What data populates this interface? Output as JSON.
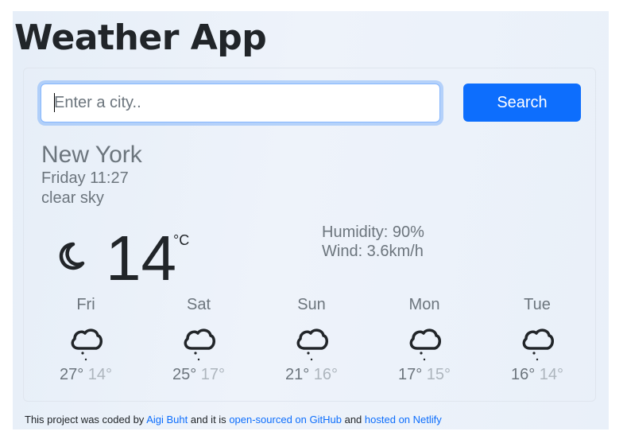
{
  "app": {
    "title": "Weather App"
  },
  "search": {
    "placeholder": "Enter a city..",
    "button_label": "Search"
  },
  "current": {
    "city": "New York",
    "datetime": "Friday 11:27",
    "description": "clear sky",
    "icon": "moon-icon",
    "temperature": "14",
    "unit": "°C",
    "humidity": "Humidity: 90%",
    "wind": "Wind: 3.6km/h"
  },
  "forecast": [
    {
      "day": "Fri",
      "max": "27°",
      "min": "14°",
      "icon": "cloud-drizzle-icon"
    },
    {
      "day": "Sat",
      "max": "25°",
      "min": "17°",
      "icon": "cloud-drizzle-icon"
    },
    {
      "day": "Sun",
      "max": "21°",
      "min": "16°",
      "icon": "cloud-drizzle-icon"
    },
    {
      "day": "Mon",
      "max": "17°",
      "min": "15°",
      "icon": "cloud-drizzle-icon"
    },
    {
      "day": "Tue",
      "max": "16°",
      "min": "14°",
      "icon": "cloud-drizzle-icon"
    }
  ],
  "footer": {
    "prefix": "This project was coded by",
    "author_link": "Aigi Buht",
    "middle": "and it is",
    "github_link": "open-sourced on GitHub",
    "and": "and",
    "netlify_link": "hosted on Netlify"
  },
  "colors": {
    "accent": "#0d6efd",
    "text_muted": "#6c757d",
    "text_light": "#adb5bd",
    "text_dark": "#212529"
  }
}
